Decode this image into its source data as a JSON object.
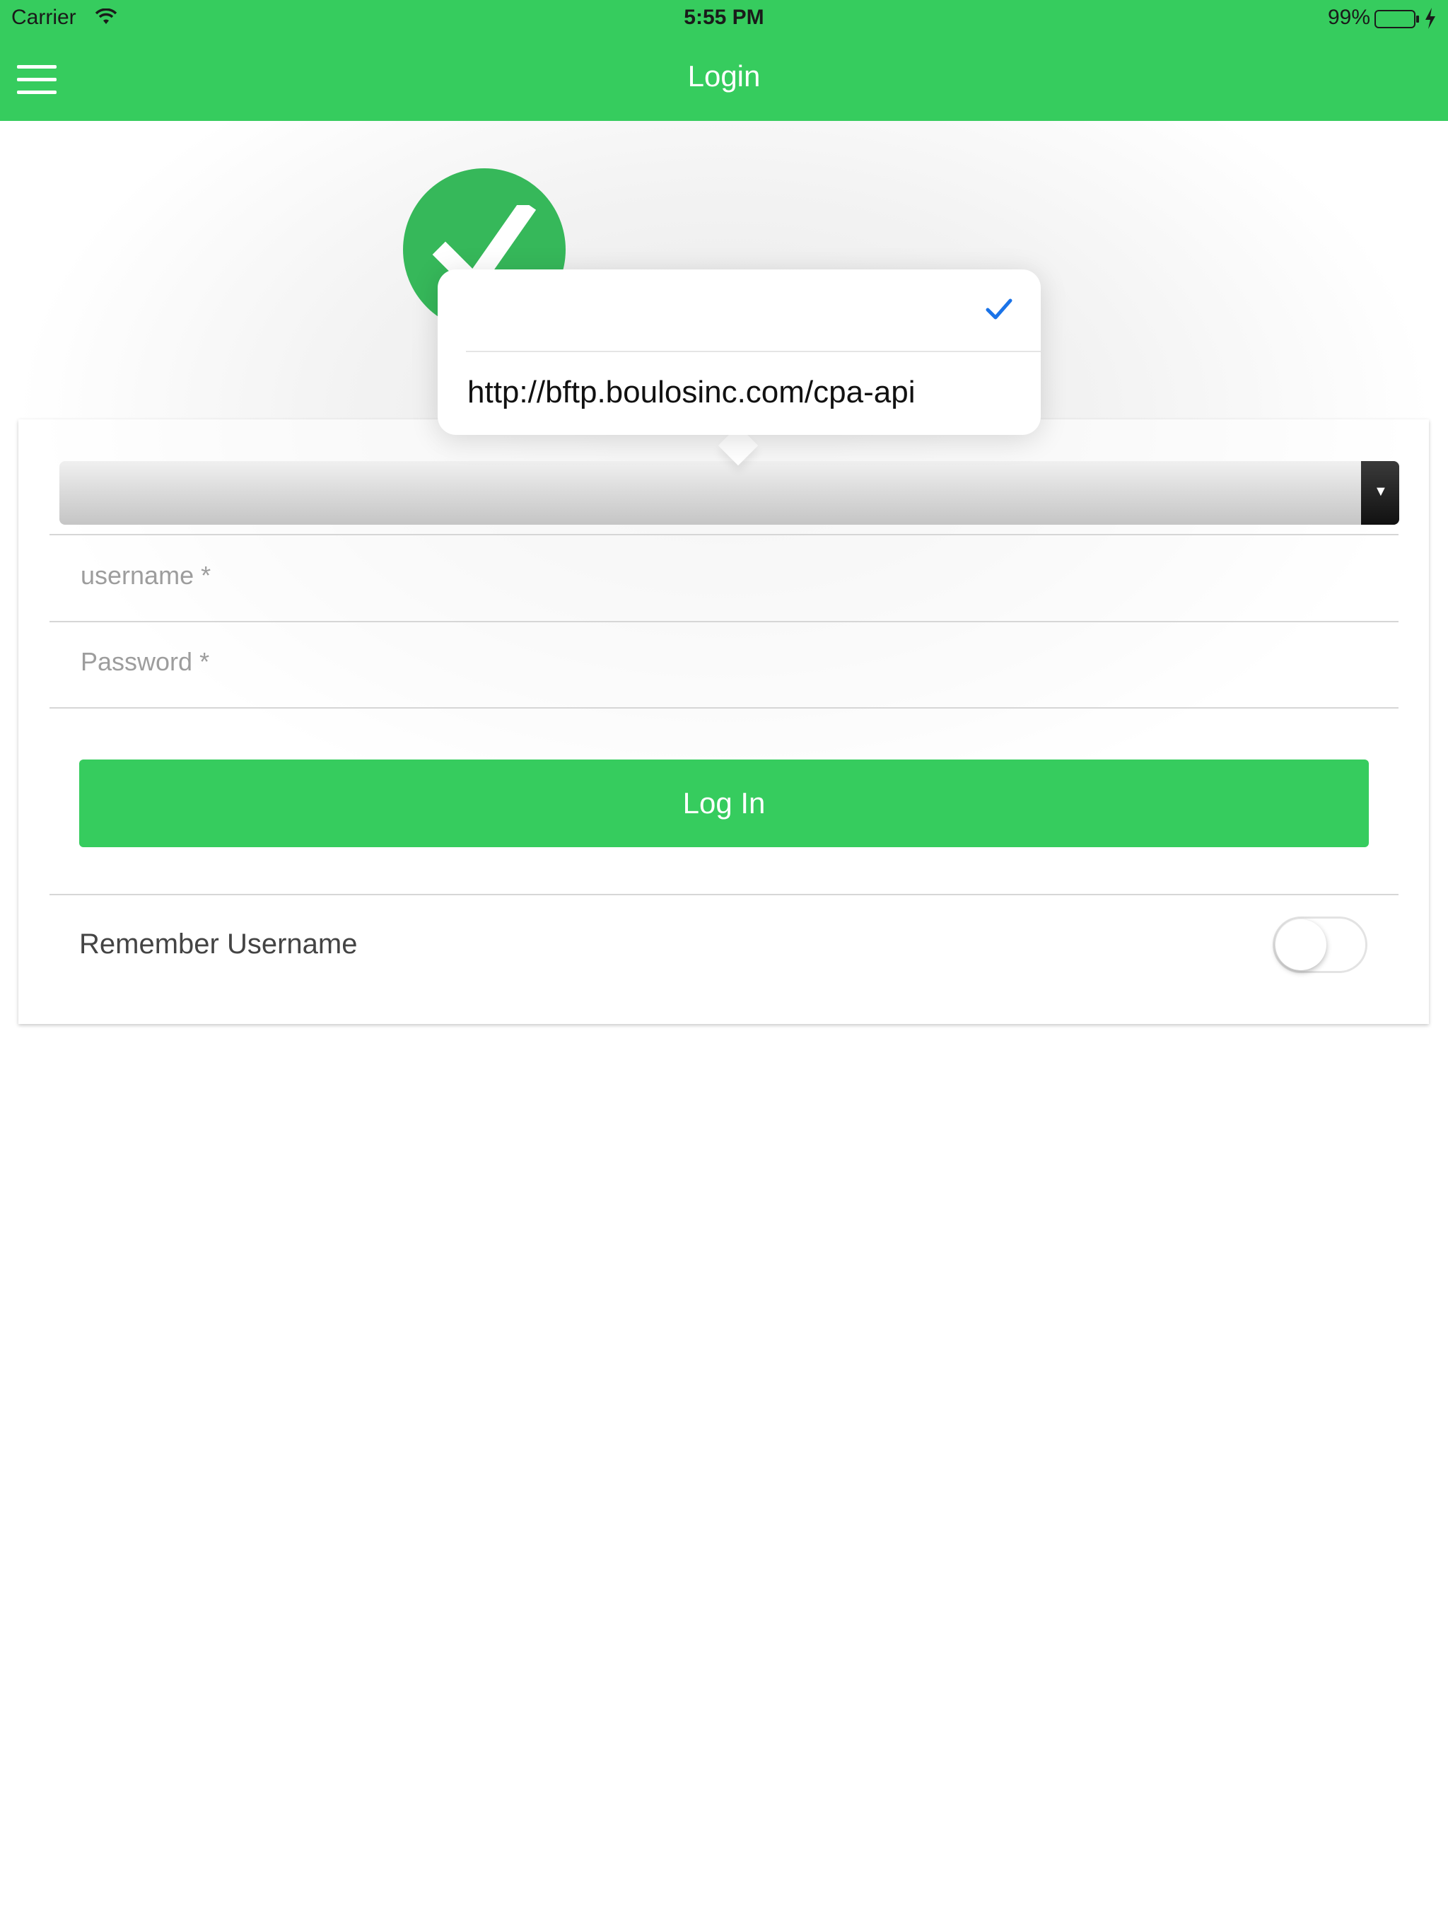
{
  "status_bar": {
    "carrier": "Carrier",
    "time": "5:55 PM",
    "battery": "99%"
  },
  "nav": {
    "title": "Login",
    "menu_icon": "hamburger-menu-icon"
  },
  "brand": {
    "logo_icon": "green-check-logo-icon",
    "logo_color": "#36b85a"
  },
  "form": {
    "server_select": {
      "selected_value": "",
      "options": [
        "",
        "http://bftp.boulosinc.com/cpa-api"
      ]
    },
    "username": {
      "value": "",
      "placeholder": "username *"
    },
    "password": {
      "value": "",
      "placeholder": "Password *"
    },
    "login_button": "Log In",
    "remember_label": "Remember Username",
    "remember_on": false
  },
  "popover": {
    "items": [
      {
        "label": "",
        "selected": true
      },
      {
        "label": "http://bftp.boulosinc.com/cpa-api",
        "selected": false
      }
    ]
  },
  "colors": {
    "accent": "#36cc5e",
    "checkmark": "#1a73e8"
  }
}
